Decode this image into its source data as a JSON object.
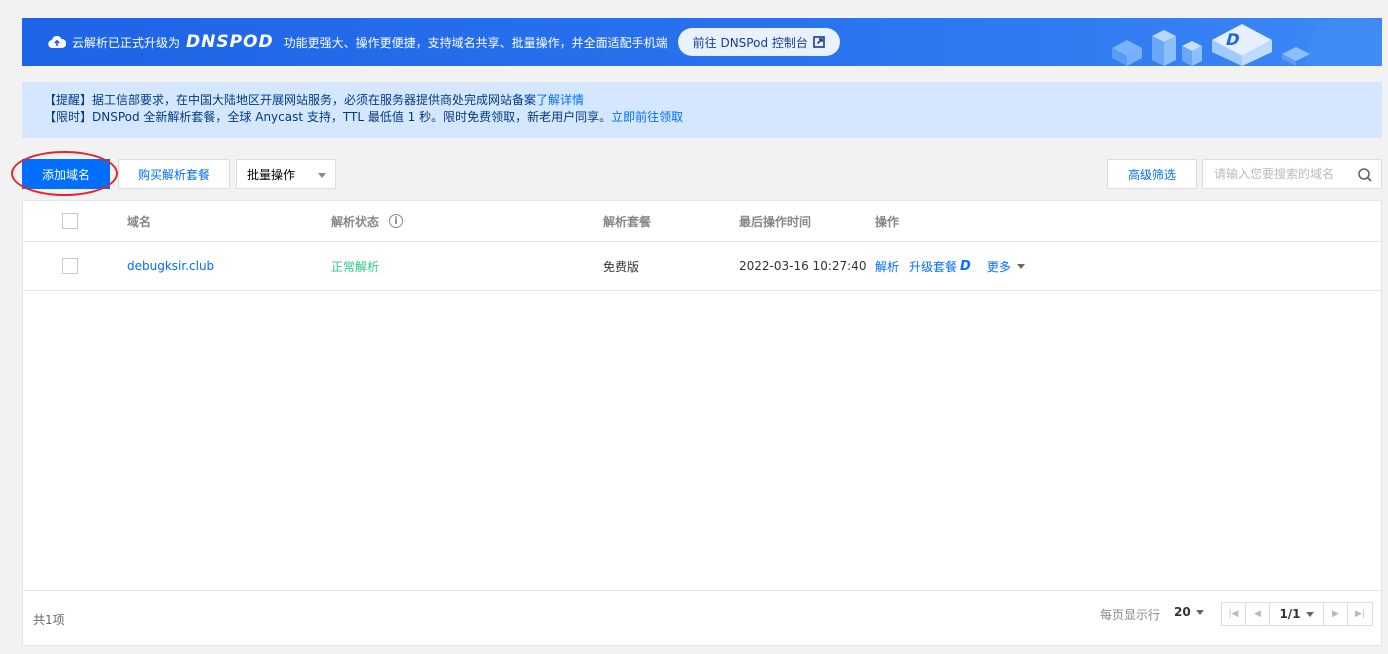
{
  "banner": {
    "prefix": "云解析已正式升级为",
    "logo_text": "DNSPOD",
    "features": "功能更强大、操作更便捷，支持域名共享、批量操作，并全面适配手机端",
    "console_button": "前往 DNSPod 控制台"
  },
  "notice": {
    "line1_text": "【提醒】据工信部要求，在中国大陆地区开展网站服务，必须在服务器提供商处完成网站备案",
    "line1_link": "了解详情",
    "line2_text": "【限时】DNSPod 全新解析套餐，全球 Anycast 支持，TTL 最低值 1 秒。限时免费领取，新老用户同享。",
    "line2_link": "立即前往领取"
  },
  "toolbar": {
    "add_domain": "添加域名",
    "buy_package": "购买解析套餐",
    "batch_ops": "批量操作",
    "advanced_filter": "高级筛选",
    "search_placeholder": "请输入您要搜索的域名"
  },
  "table": {
    "headers": {
      "domain": "域名",
      "status": "解析状态",
      "package": "解析套餐",
      "last_op_time": "最后操作时间",
      "actions": "操作"
    },
    "rows": [
      {
        "domain": "debugksir.club",
        "status": "正常解析",
        "package": "免费版",
        "last_op_time": "2022-03-16 10:27:40",
        "action_resolve": "解析",
        "action_upgrade": "升级套餐",
        "action_upgrade_badge": "D",
        "action_more": "更多"
      }
    ],
    "footer": {
      "total": "共1项",
      "per_page_label": "每页显示行",
      "per_page": "20",
      "page": "1/1"
    }
  },
  "colors": {
    "primary": "#006eff",
    "banner_blue": "#1d64e6",
    "status_ok": "#29cc85",
    "highlight_red": "#e8242b"
  }
}
